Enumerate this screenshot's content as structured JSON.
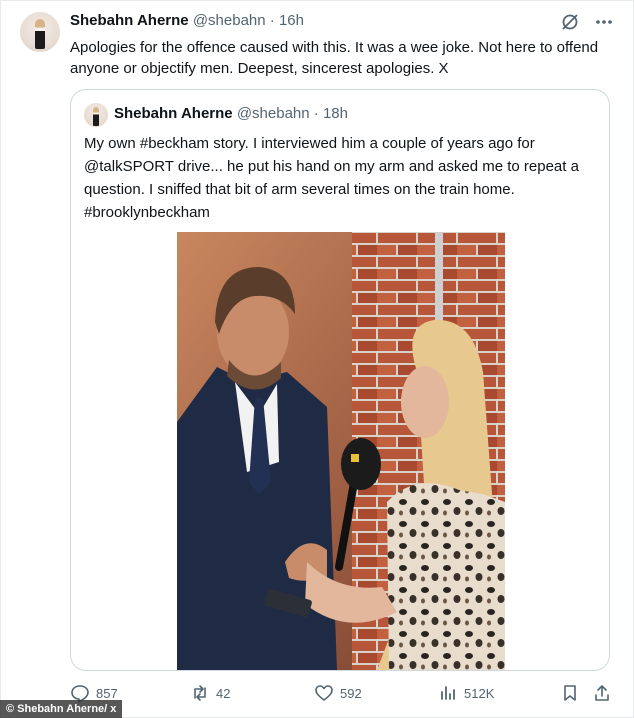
{
  "tweet": {
    "author_name": "Shebahn Aherne",
    "handle": "@shebahn",
    "time": "16h",
    "separator": "·",
    "text": "Apologies for the offence caused with this. It was a wee joke. Not here to offend anyone or objectify men. Deepest, sincerest apologies. X",
    "icons": [
      "grok-icon",
      "more-icon"
    ]
  },
  "quoted": {
    "author_name": "Shebahn Aherne",
    "handle": "@shebahn",
    "time": "18h",
    "separator": "·",
    "text": "My own #beckham story. I interviewed him a couple of years ago for @talkSPORT drive... he put his hand on my arm and asked me to repeat a question. I sniffed that bit of arm several times on the train home. #brooklynbeckham"
  },
  "actions": {
    "replies": "857",
    "reposts": "42",
    "likes": "592",
    "views": "512K"
  },
  "caption": "© Shebahn Aherne/ x",
  "colors": {
    "text": "#0f1419",
    "muted": "#536471",
    "border": "#cfd9de"
  }
}
